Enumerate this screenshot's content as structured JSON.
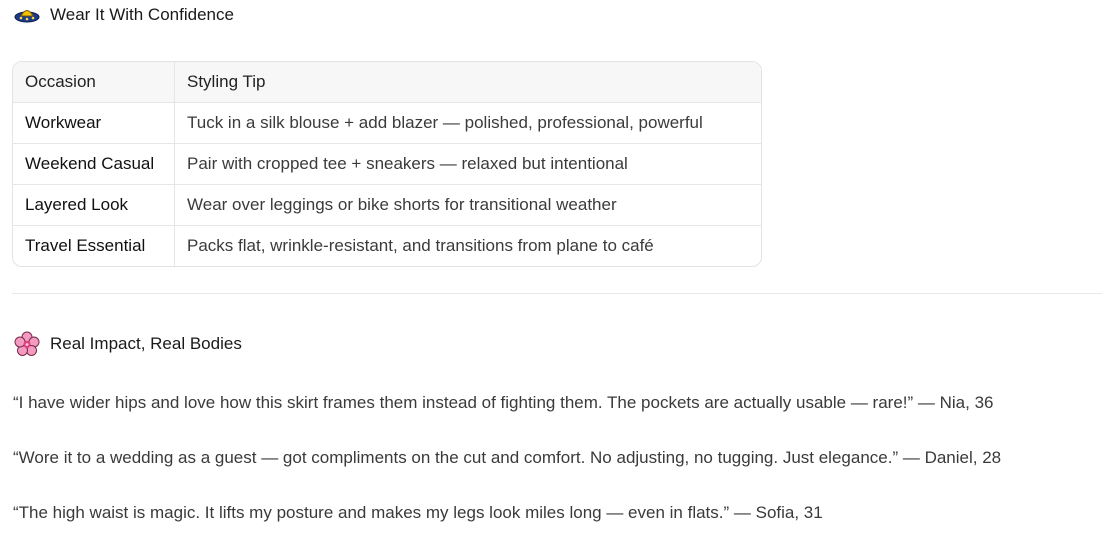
{
  "sections": {
    "wear": {
      "icon": "ufo-icon",
      "title": "Wear It With Confidence"
    },
    "impact": {
      "icon": "cherry-blossom-icon",
      "title": "Real Impact, Real Bodies"
    }
  },
  "table": {
    "headers": [
      "Occasion",
      "Styling Tip"
    ],
    "rows": [
      {
        "occasion": "Workwear",
        "tip": "Tuck in a silk blouse + add blazer — polished, professional, powerful"
      },
      {
        "occasion": "Weekend Casual",
        "tip": "Pair with cropped tee + sneakers — relaxed but intentional"
      },
      {
        "occasion": "Layered Look",
        "tip": "Wear over leggings or bike shorts for transitional weather"
      },
      {
        "occasion": "Travel Essential",
        "tip": "Packs flat, wrinkle-resistant, and transitions from plane to café"
      }
    ]
  },
  "testimonials": [
    "“I have wider hips and love how this skirt frames them instead of fighting them. The pockets are actually usable — rare!” — Nia, 36",
    "“Wore it to a wedding as a guest — got compliments on the cut and comfort. No adjusting, no tugging. Just elegance.” — Daniel, 28",
    "“The high waist is magic. It lifts my posture and makes my legs look miles long — even in flats.” — Sofia, 31"
  ]
}
